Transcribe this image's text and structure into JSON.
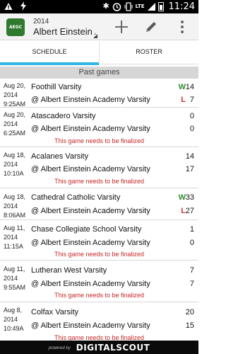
{
  "status_bar": {
    "left_icons": [
      "warning-icon",
      "flash-icon"
    ],
    "right_icons": [
      "bluetooth-icon",
      "alarm-icon",
      "vibrate-icon",
      "lte-icon",
      "signal-icon",
      "battery-icon"
    ],
    "time": "11:24"
  },
  "header": {
    "logo_text": "AEGC",
    "year": "2014",
    "team_name": "Albert Einstein Academy Varsity"
  },
  "tabs": [
    {
      "label": "SCHEDULE",
      "active": true
    },
    {
      "label": "ROSTER",
      "active": false
    }
  ],
  "section_title": "Past games",
  "games": [
    {
      "date": "Aug 20, 2014",
      "time": "9:25AM",
      "home": "Foothill Varsity",
      "away": "@ Albert Einstein Academy Varsity",
      "home_score": "14",
      "away_score": "7",
      "home_result": "W",
      "away_result": "L",
      "notice": ""
    },
    {
      "date": "Aug 20, 2014",
      "time": "6:25AM",
      "home": "Atascadero Varsity",
      "away": "@ Albert Einstein Academy Varsity",
      "home_score": "0",
      "away_score": "0",
      "home_result": "",
      "away_result": "",
      "notice": "This game needs to be finalized"
    },
    {
      "date": "Aug 18, 2014",
      "time": "10:10A",
      "home": "Acalanes Varsity",
      "away": "@ Albert Einstein Academy Varsity",
      "home_score": "14",
      "away_score": "17",
      "home_result": "",
      "away_result": "",
      "notice": "This game needs to be finalized"
    },
    {
      "date": "Aug 18, 2014",
      "time": "8:06AM",
      "home": "Cathedral Catholic Varsity",
      "away": "@ Albert Einstein Academy Varsity",
      "home_score": "33",
      "away_score": "27",
      "home_result": "W",
      "away_result": "L",
      "notice": ""
    },
    {
      "date": "Aug 11, 2014",
      "time": "11:15A",
      "home": "Chase Collegiate School Varsity",
      "away": "@ Albert Einstein Academy Varsity",
      "home_score": "1",
      "away_score": "0",
      "home_result": "",
      "away_result": "",
      "notice": "This game needs to be finalized"
    },
    {
      "date": "Aug 11, 2014",
      "time": "9:55AM",
      "home": "Lutheran West Varsity",
      "away": "@ Albert Einstein Academy Varsity",
      "home_score": "7",
      "away_score": "7",
      "home_result": "",
      "away_result": "",
      "notice": "This game needs to be finalized"
    },
    {
      "date": "Aug 8, 2014",
      "time": "10:49A",
      "home": "Colfax Varsity",
      "away": "@ Albert Einstein Academy Varsity",
      "home_score": "20",
      "away_score": "15",
      "home_result": "",
      "away_result": "",
      "notice": "This game needs to be finalized"
    }
  ],
  "footer": {
    "powered_by": "powered by",
    "brand": "DIGITALSCOUT"
  },
  "colors": {
    "tab_indicator": "#33b5e5",
    "win": "#2e8b2e",
    "loss": "#d32f2f",
    "notice": "#c62828",
    "logo": "#2f7a2f"
  }
}
